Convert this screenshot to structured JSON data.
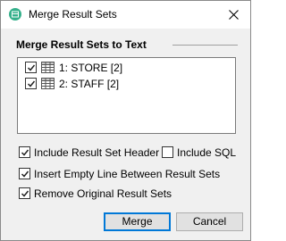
{
  "window": {
    "title": "Merge Result Sets",
    "icon": "app-logo-icon",
    "close_icon": "close-icon"
  },
  "group": {
    "title": "Merge Result Sets to Text"
  },
  "result_sets": [
    {
      "label": "1: STORE [2]",
      "checked": true,
      "icon": "grid-table-icon"
    },
    {
      "label": "2: STAFF [2]",
      "checked": true,
      "icon": "grid-table-icon"
    }
  ],
  "options": {
    "include_header": {
      "label": "Include Result Set Header",
      "checked": true
    },
    "include_sql": {
      "label": "Include SQL",
      "checked": false
    },
    "insert_empty_line": {
      "label": "Insert Empty Line Between Result Sets",
      "checked": true
    },
    "remove_original": {
      "label": "Remove Original Result Sets",
      "checked": true
    }
  },
  "buttons": {
    "merge": "Merge",
    "cancel": "Cancel"
  },
  "colors": {
    "accent": "#0078d7",
    "app_icon": "#35b08b",
    "checkbox_border": "#333333"
  }
}
